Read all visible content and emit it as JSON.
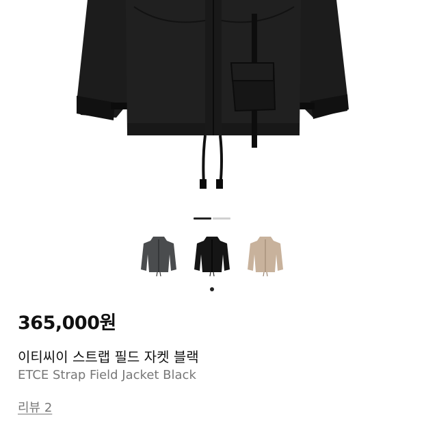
{
  "product": {
    "price": "365,000원",
    "name_ko": "이티씨이 스트랩 필드 자켓 블랙",
    "name_en": "ETCE Strap Field Jacket Black",
    "review_link": "리뷰 2"
  },
  "gallery": {
    "image": "black field jacket with straps",
    "carousel_position": 1,
    "carousel_total": 2
  },
  "color_options": [
    {
      "name": "charcoal",
      "color": "#4a4c4e",
      "selected": false
    },
    {
      "name": "black",
      "color": "#151515",
      "selected": true
    },
    {
      "name": "beige",
      "color": "#c8b29c",
      "selected": false
    }
  ],
  "colors": {
    "active_indicator": "#222222",
    "inactive_indicator": "#d0d0d0"
  }
}
